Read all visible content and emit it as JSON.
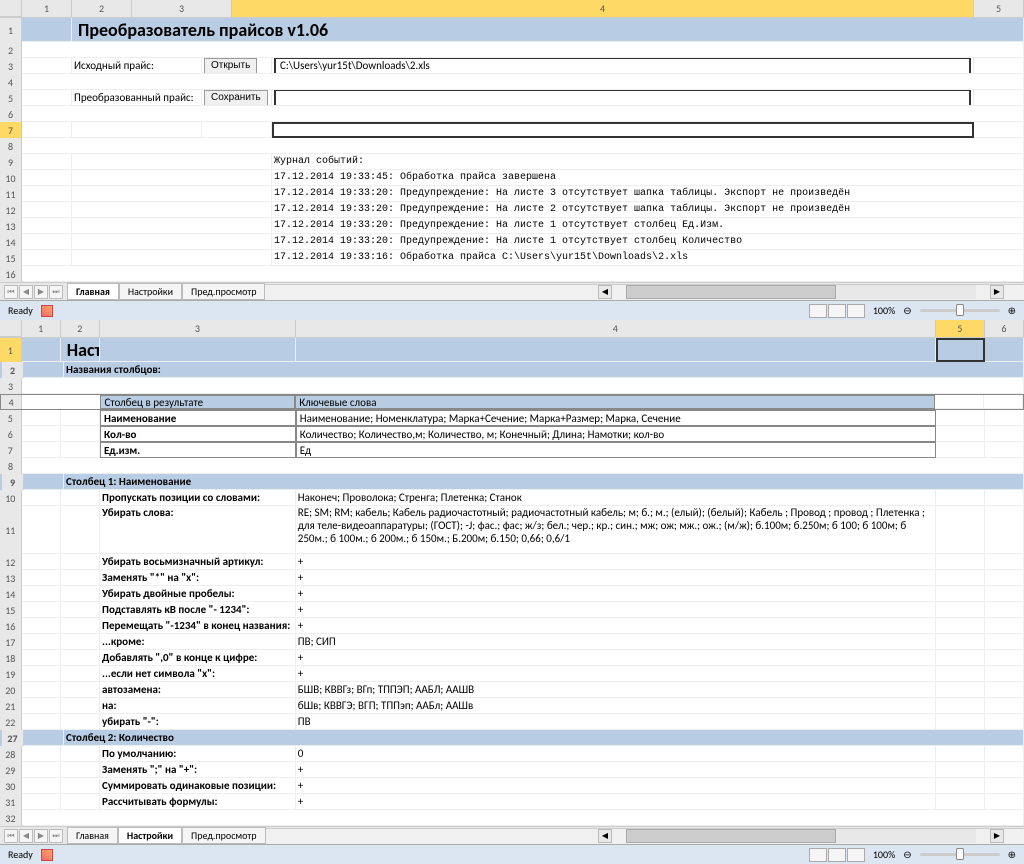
{
  "pane1": {
    "cols": [
      "1",
      "2",
      "3",
      "4",
      "5"
    ],
    "selected_col": "4",
    "selected_row": "7",
    "title": "Преобразователь прайсов v1.06",
    "labels": {
      "source": "Исходный прайс:",
      "converted": "Преобразованный прайс:",
      "open_btn": "Открыть",
      "save_btn": "Сохранить"
    },
    "source_path": "C:\\Users\\yur15t\\Downloads\\2.xls",
    "converted_path": "",
    "log_title": "Журнал событий:",
    "log": [
      "17.12.2014 19:33:45: Обработка прайса завершена",
      "17.12.2014 19:33:20: Предупреждение: На листе  3 отсутствует шапка таблицы. Экспорт не произведён",
      "17.12.2014 19:33:20: Предупреждение: На листе  2 отсутствует шапка таблицы. Экспорт не произведён",
      "17.12.2014 19:33:20: Предупреждение: На листе  1 отсутствует столбец Ед.Изм.",
      "17.12.2014 19:33:20: Предупреждение: На листе  1 отсутствует столбец Количество",
      "17.12.2014 19:33:16: Обработка прайса C:\\Users\\yur15t\\Downloads\\2.xls"
    ],
    "tabs": [
      "Главная",
      "Настройки",
      "Пред.просмотр"
    ],
    "active_tab": 0,
    "status": "Ready",
    "zoom": "100%"
  },
  "pane2": {
    "cols": [
      "1",
      "2",
      "3",
      "4",
      "5",
      "6"
    ],
    "selected_col": "5",
    "selected_row": "1",
    "title": "Настройки",
    "sections": {
      "col_names": "Названия столбцов:",
      "col1": "Столбец 1: Наименование",
      "col2": "Столбец 2: Количество"
    },
    "table": {
      "h1": "Столбец в результате",
      "h2": "Ключевые слова",
      "rows": [
        {
          "c": "Наименование",
          "k": "Наименование; Номенклатура; Марка+Сечение; Марка+Размер; Марка, Сечение"
        },
        {
          "c": "Кол-во",
          "k": "Количество; Количество,м; Количество, м; Конечный; Длина; Намотки; кол-во"
        },
        {
          "c": "Ед.изм.",
          "k": "Ед"
        }
      ]
    },
    "col1_settings": [
      {
        "label": "Пропускать позиции со словами:",
        "val": "Наконеч; Проволока; Стренга; Плетенка; Станок"
      },
      {
        "label": "Убирать слова:",
        "val": "RE; SM; RM;  кабель; Кабель радиочастотный;  радиочастотный кабель; м; б.; м.; (елый);  (белый); Кабель ; Провод ; провод ; Плетенка ;  для теле-видеоаппаратуры; (ГОСТ); -J; фас.; фас; ж/з; бел.; чер.; кр.; син.; мж; ож; мж.; ож.; (м/ж); б.100м; б.250м; б 100; б 100м; б 250м.; б 100м.; б 200м.; б 150м.; Б.200м; б.150; 0,66; 0,6/1"
      },
      {
        "label": "Убирать восьмизначный артикул:",
        "val": "+"
      },
      {
        "label": "Заменять \"*\" на \"х\":",
        "val": "+"
      },
      {
        "label": "Убирать двойные пробелы:",
        "val": "+"
      },
      {
        "label": "Подставлять кВ после \"- 1234\":",
        "val": "+"
      },
      {
        "label": "Перемещать \"-1234\" в конец названия:",
        "val": "+"
      },
      {
        "label": "...кроме:",
        "val": "ПВ; СИП"
      },
      {
        "label": "Добавлять \",0\" в конце к цифре:",
        "val": "+"
      },
      {
        "label": "...если нет символа \"х\":",
        "val": "+"
      },
      {
        "label": "автозамена:",
        "val": "БШВ; КВВГз; ВГп; ТППЭП; ААБЛ; ААШВ"
      },
      {
        "label": "на:",
        "val": "бШв; КВВГЭ; ВГП; ТППэп; ААБл; ААШв"
      },
      {
        "label": "убирать \"-\":",
        "val": "ПВ"
      }
    ],
    "col2_settings": [
      {
        "label": "По умолчанию:",
        "val": "0"
      },
      {
        "label": "Заменять \";\" на \"+\":",
        "val": "+"
      },
      {
        "label": "Суммировать одинаковые позиции:",
        "val": "+"
      },
      {
        "label": "Рассчитывать формулы:",
        "val": "+"
      }
    ],
    "tabs": [
      "Главная",
      "Настройки",
      "Пред.просмотр"
    ],
    "active_tab": 1,
    "status": "Ready",
    "zoom": "100%"
  }
}
